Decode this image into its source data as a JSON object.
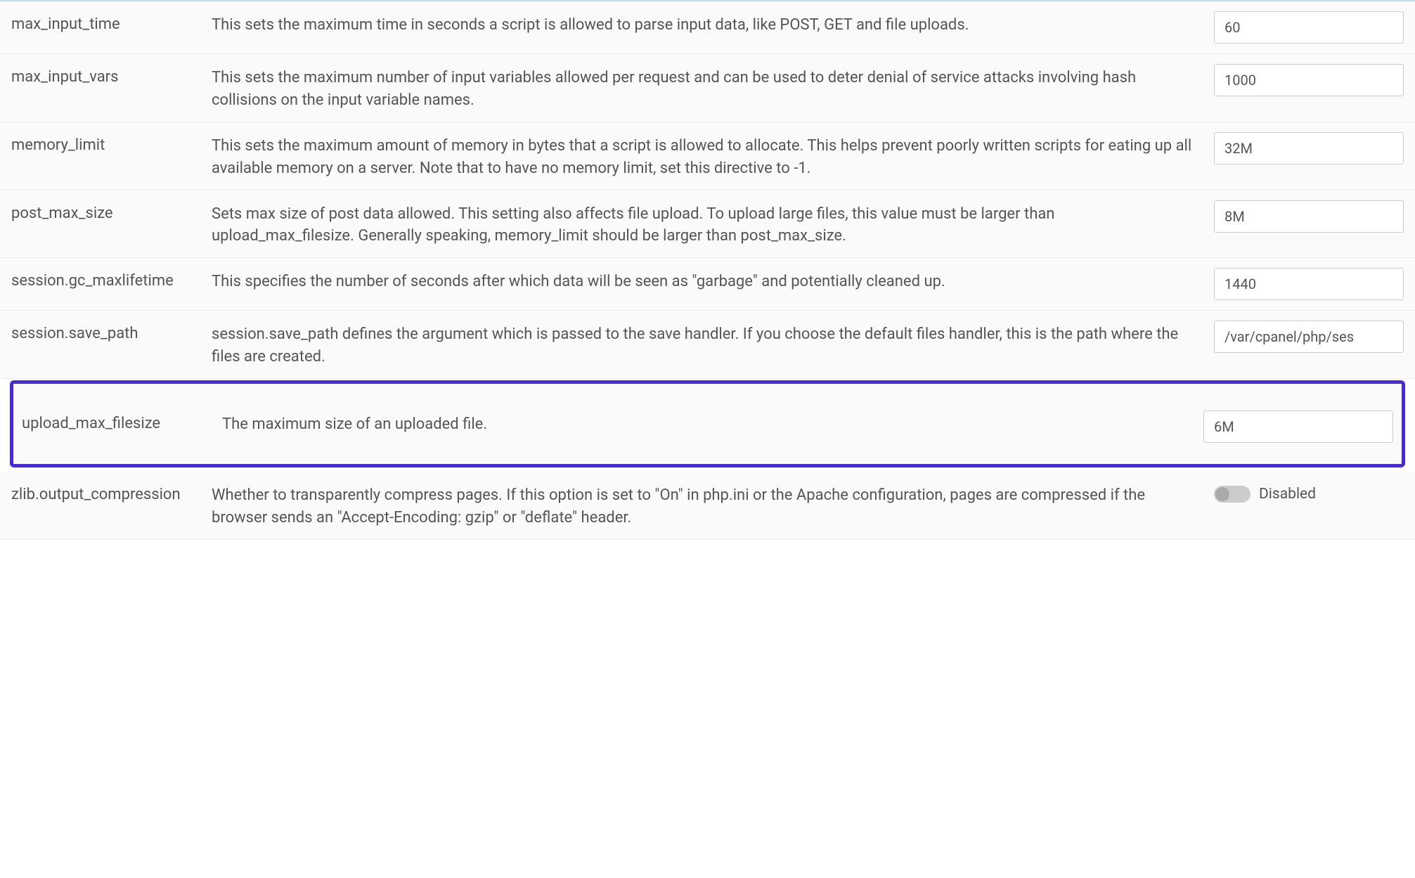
{
  "rows": [
    {
      "name": "max_input_time",
      "desc": "This sets the maximum time in seconds a script is allowed to parse input data, like POST, GET and file uploads.",
      "value": "60",
      "type": "text",
      "highlighted": false
    },
    {
      "name": "max_input_vars",
      "desc": "This sets the maximum number of input variables allowed per request and can be used to deter denial of service attacks involving hash collisions on the input variable names.",
      "value": "1000",
      "type": "text",
      "highlighted": false
    },
    {
      "name": "memory_limit",
      "desc": "This sets the maximum amount of memory in bytes that a script is allowed to allocate. This helps prevent poorly written scripts for eating up all available memory on a server. Note that to have no memory limit, set this directive to -1.",
      "value": "32M",
      "type": "text",
      "highlighted": false
    },
    {
      "name": "post_max_size",
      "desc": "Sets max size of post data allowed. This setting also affects file upload. To upload large files, this value must be larger than upload_max_filesize. Generally speaking, memory_limit should be larger than post_max_size.",
      "value": "8M",
      "type": "text",
      "highlighted": false
    },
    {
      "name": "session.gc_maxlifetime",
      "desc": "This specifies the number of seconds after which data will be seen as \"garbage\" and potentially cleaned up.",
      "value": "1440",
      "type": "text",
      "highlighted": false
    },
    {
      "name": "session.save_path",
      "desc": "session.save_path defines the argument which is passed to the save handler. If you choose the default files handler, this is the path where the files are created.",
      "value": "/var/cpanel/php/ses",
      "type": "text",
      "highlighted": false
    },
    {
      "name": "upload_max_filesize",
      "desc": "The maximum size of an uploaded file.",
      "value": "6M",
      "type": "text",
      "highlighted": true
    },
    {
      "name": "zlib.output_compression",
      "desc": "Whether to transparently compress pages. If this option is set to \"On\" in php.ini or the Apache configuration, pages are compressed if the browser sends an \"Accept-Encoding: gzip\" or \"deflate\" header.",
      "value": "Disabled",
      "type": "toggle",
      "highlighted": false
    }
  ]
}
